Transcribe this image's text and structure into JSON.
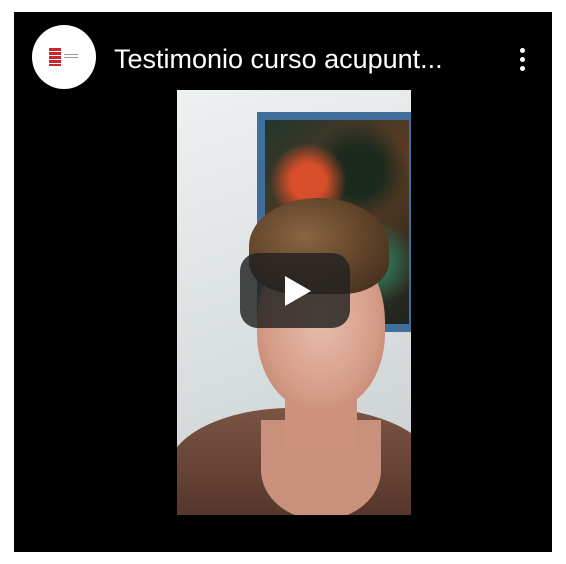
{
  "video": {
    "title": "Testimonio curso acupunt...",
    "channel_avatar_icon": "channel-logo-icon",
    "more_icon": "more-vert-icon",
    "play_icon": "play-icon"
  },
  "colors": {
    "player_background": "#000000",
    "title_text": "#ffffff",
    "logo_accent": "#c8262d"
  }
}
